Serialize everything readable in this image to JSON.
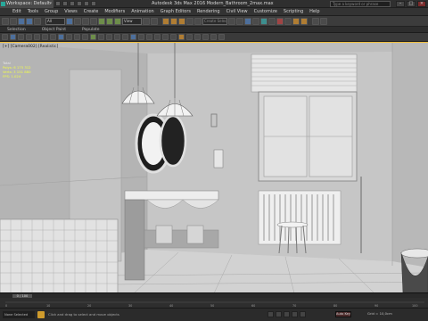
{
  "window": {
    "workspace": "Workspace: Default",
    "title": "Autodesk 3ds Max 2016    Modern_Bathroom_2max.max",
    "search_placeholder": "Type a keyword or phrase"
  },
  "menu": [
    "Edit",
    "Tools",
    "Group",
    "Views",
    "Create",
    "Modifiers",
    "Animation",
    "Graph Editors",
    "Rendering",
    "Civil View",
    "Customize",
    "Scripting",
    "Help"
  ],
  "toolbar": {
    "selection_filter": "All",
    "view_dropdown": "View",
    "named_selection_placeholder": "Create Selection Se"
  },
  "ribbon": [
    "Selection",
    "Object Paint",
    "Populate"
  ],
  "viewport": {
    "label": "[+] [Camera002] [Realistic]",
    "stats": {
      "header": "Total",
      "polys_label": "Polys:",
      "polys_value": "6 175 312",
      "verts_label": "Verts:",
      "verts_value": "3 151 880",
      "fps_label": "FPS:",
      "fps_value": "1.024"
    }
  },
  "timeline": {
    "frame_display": "0 / 100",
    "ticks": [
      "0",
      "10",
      "20",
      "30",
      "40",
      "50",
      "60",
      "70",
      "80",
      "90",
      "100"
    ]
  },
  "status": {
    "left": "None Selected",
    "prompt": "Click and drag to select and move objects",
    "key_mode": "Auto Key",
    "coords": "Grid = 10,0cm"
  },
  "colors": {
    "viewport_bg": "#bdbdbd",
    "active_border": "#f0c040",
    "stats_text": "#f4ff46",
    "ui_dark": "#3a3a3a",
    "lock_orange": "#cf9b2c"
  }
}
